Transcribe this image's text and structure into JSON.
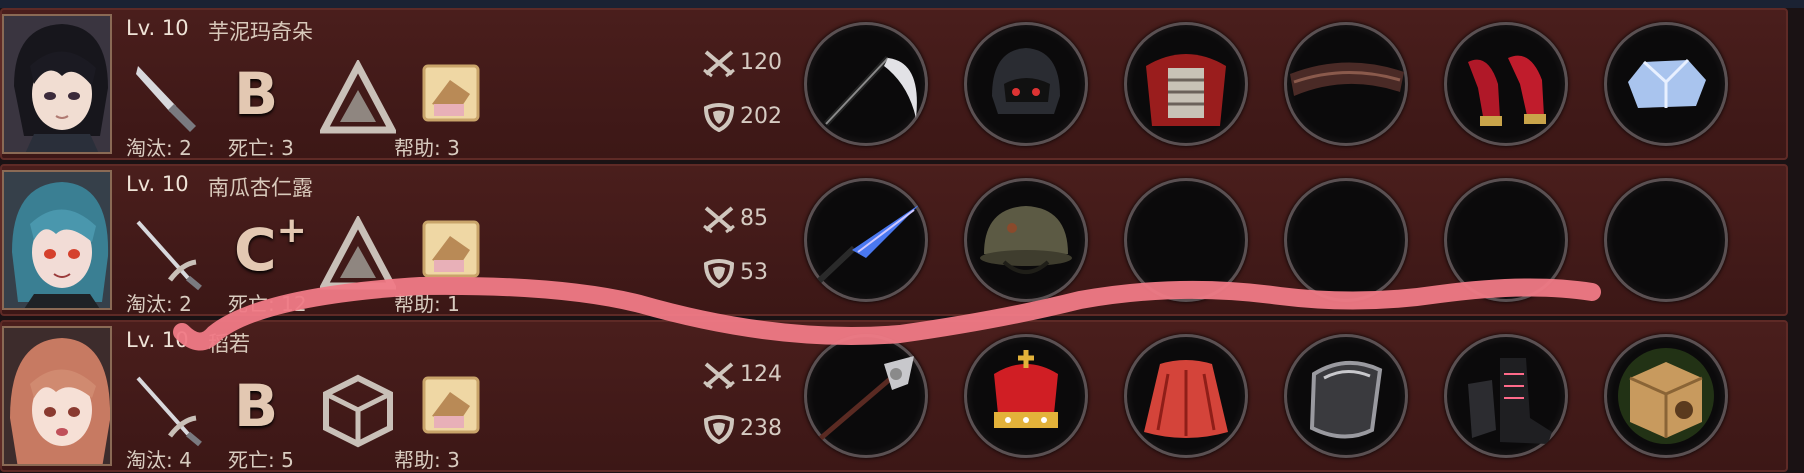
{
  "players": [
    {
      "level": "Lv. 10",
      "name": "芋泥玛奇朵",
      "weapon_icon": "knife-icon",
      "rank": "B",
      "rank_plus": "",
      "tier_icon": "triangle-tier-icon",
      "eliminations_label": "淘汰: 2",
      "deaths_label": "死亡: 3",
      "assists_label": "帮助: 3",
      "attack": "120",
      "defense": "202",
      "equipment": [
        "scythe-icon",
        "tactical-helmet-icon",
        "red-armor-icon",
        "wooden-bracer-icon",
        "red-heels-icon",
        "ice-crystal-icon"
      ]
    },
    {
      "level": "Lv. 10",
      "name": "南瓜杏仁露",
      "weapon_icon": "rapier-icon",
      "rank": "C",
      "rank_plus": "+",
      "tier_icon": "triangle-tier-icon",
      "eliminations_label": "淘汰: 2",
      "deaths_label": "死亡: 12",
      "assists_label": "帮助: 1",
      "attack": "85",
      "defense": "53",
      "equipment": [
        "blue-spear-icon",
        "army-helmet-icon",
        "empty-slot",
        "empty-slot",
        "empty-slot",
        "empty-slot"
      ]
    },
    {
      "level": "Lv. 10",
      "name": "稻若",
      "weapon_icon": "rapier-icon",
      "rank": "B",
      "rank_plus": "",
      "tier_icon": "cube-tier-icon",
      "eliminations_label": "淘汰: 4",
      "deaths_label": "死亡: 5",
      "assists_label": "帮助: 3",
      "attack": "124",
      "defense": "238",
      "equipment": [
        "halberd-icon",
        "crown-icon",
        "red-cloak-icon",
        "black-shield-icon",
        "combat-boots-icon",
        "cat-crate-icon"
      ]
    }
  ],
  "colors": {
    "panel": "#461c1b",
    "scribble": "#f07a86"
  }
}
